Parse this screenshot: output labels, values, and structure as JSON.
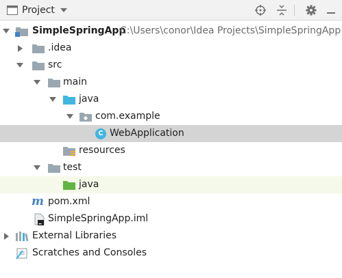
{
  "panel": {
    "title": "Project"
  },
  "tree": {
    "root": {
      "name": "SimpleSpringApp",
      "path": "C:\\Users\\conor\\Idea Projects\\SimpleSpringApp"
    },
    "idea": ".idea",
    "src": "src",
    "main": "main",
    "main_java": "java",
    "package": "com.example",
    "class_file": "WebApplication",
    "class_badge": "C",
    "resources": "resources",
    "test": "test",
    "test_java": "java",
    "pom": "pom.xml",
    "pom_icon_letter": "m",
    "iml": "SimpleSpringApp.iml",
    "external_libraries": "External Libraries",
    "scratches": "Scratches and Consoles"
  },
  "colors": {
    "folder_gray": "#9aa7b0",
    "folder_blue": "#40b6e0",
    "folder_green": "#62b543",
    "selection": "#d4d4d4",
    "test_highlight": "#f4f9ea",
    "maven_blue": "#4083c9"
  }
}
